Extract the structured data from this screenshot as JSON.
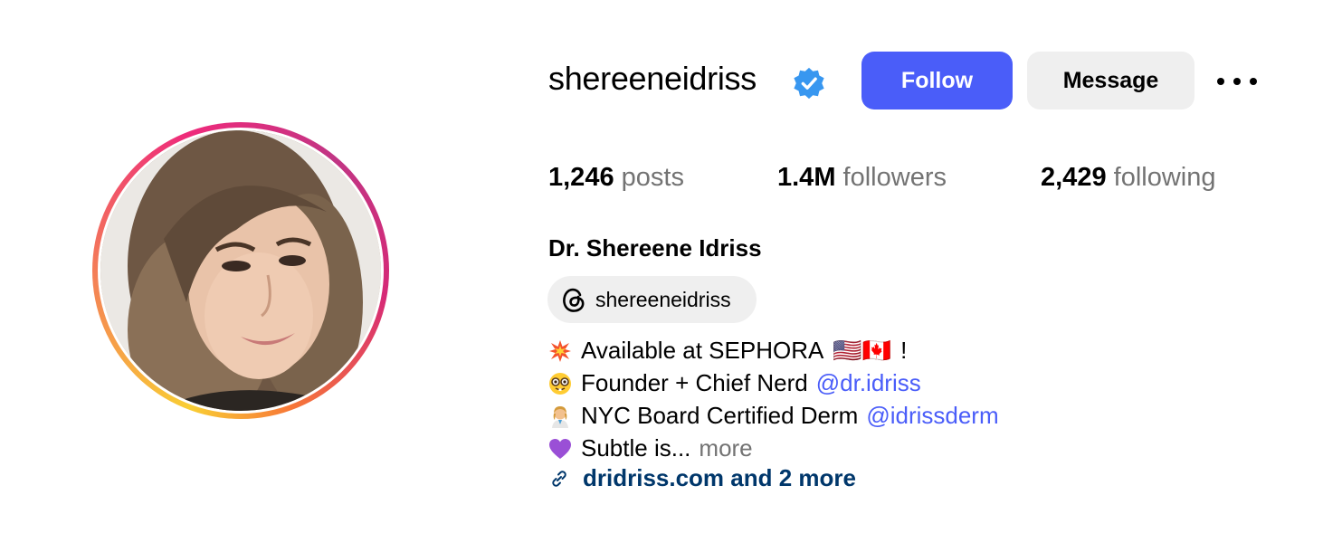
{
  "profile": {
    "username": "shereeneidriss",
    "full_name": "Dr. Shereene Idriss",
    "verified_icon": "verified-badge-icon",
    "follow_label": "Follow",
    "message_label": "Message",
    "more_icon": "more-options-icon"
  },
  "stats": {
    "posts_count": "1,246",
    "posts_label": "posts",
    "followers_count": "1.4M",
    "followers_label": "followers",
    "following_count": "2,429",
    "following_label": "following"
  },
  "threads": {
    "icon": "threads-icon",
    "handle": "shereeneidriss"
  },
  "bio": {
    "line1": {
      "emoji": "collision-emoji",
      "text": "Available at SEPHORA",
      "flags": "🇺🇸🇨🇦",
      "suffix": "!"
    },
    "line2": {
      "emoji": "nerd-face-emoji",
      "text": "Founder + Chief Nerd",
      "mention": "@dr.idriss"
    },
    "line3": {
      "emoji": "health-worker-emoji",
      "text": "NYC Board Certified Derm",
      "mention": "@idrissderm"
    },
    "line4": {
      "emoji": "purple-heart-emoji",
      "text": "Subtle is...",
      "more": "more"
    },
    "link": {
      "icon": "link-icon",
      "text": "dridriss.com and 2 more"
    }
  },
  "colors": {
    "accent": "#4a5df9",
    "link": "#00376b",
    "muted": "#737373",
    "button_gray": "#efefef"
  }
}
